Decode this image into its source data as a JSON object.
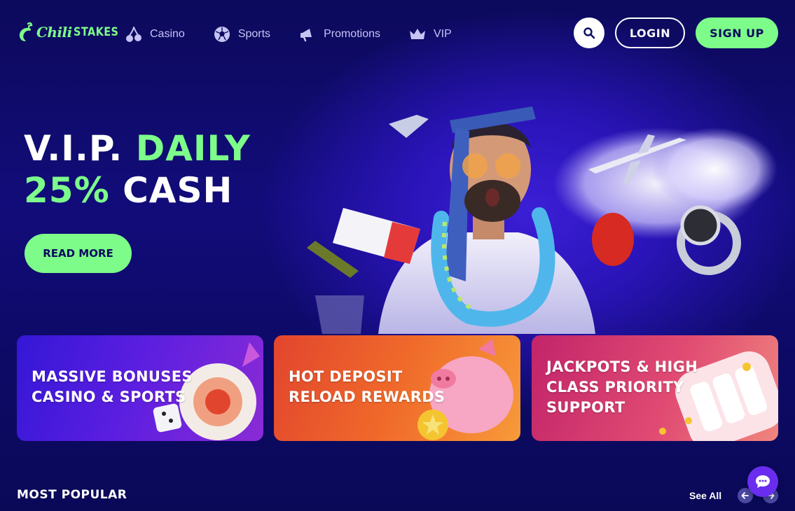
{
  "header": {
    "logo_primary": "Chili",
    "logo_secondary": "STAKES",
    "nav": [
      {
        "label": "Casino",
        "icon": "cherries-icon"
      },
      {
        "label": "Sports",
        "icon": "soccer-ball-icon"
      },
      {
        "label": "Promotions",
        "icon": "megaphone-icon"
      },
      {
        "label": "VIP",
        "icon": "crown-icon"
      }
    ],
    "search_icon": "search-icon",
    "login_label": "LOGIN",
    "signup_label": "SIGN UP"
  },
  "hero": {
    "line1_white": "V.I.P.",
    "line1_green": "DAILY",
    "line2_green": "25%",
    "line2_white": "CASH",
    "cta_label": "READ MORE"
  },
  "cards": [
    {
      "line1": "MASSIVE BONUSES",
      "line2": "CASINO & SPORTS"
    },
    {
      "line1": "HOT DEPOSIT",
      "line2": "RELOAD REWARDS"
    },
    {
      "line1": "JACKPOTS & HIGH",
      "line2": "CLASS PRIORITY",
      "line3": "SUPPORT"
    }
  ],
  "popular": {
    "title": "MOST POPULAR",
    "see_all": "See All"
  },
  "colors": {
    "background": "#0b0a5e",
    "accent_green": "#7dfc8a",
    "nav_text": "#c7c3f4",
    "chat_button": "#6a2df0"
  }
}
